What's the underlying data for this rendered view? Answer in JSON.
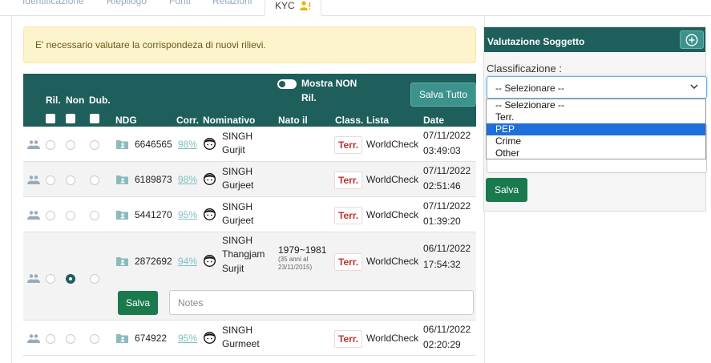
{
  "tabs": [
    {
      "label": "Identificazione"
    },
    {
      "label": "Riepilogo"
    },
    {
      "label": "Fonti"
    },
    {
      "label": "Relazioni"
    },
    {
      "label": "KYC"
    }
  ],
  "alert": "E' necessario valutare la corrispondeza di nuovi rilievi.",
  "table": {
    "headers": {
      "ril": "Ril.",
      "non": "Non",
      "dub": "Dub.",
      "ndg": "NDG",
      "corr": "Corr.",
      "nominativo": "Nominativo",
      "nato": "Nato il",
      "class": "Class.",
      "lista": "Lista",
      "date": "Date"
    },
    "toggle_label_1": "Mostra NON",
    "toggle_label_2": "Ril.",
    "save_all": "Salva Tutto",
    "rows": [
      {
        "ndg": "6646565",
        "corr": "98%",
        "name1": "SINGH",
        "name2": "Gurjit",
        "name3": "",
        "nato": "",
        "nato_note1": "",
        "nato_note2": "",
        "class": "Terr.",
        "lista": "WorldCheck",
        "date": "07/11/2022",
        "time": "03:49:03"
      },
      {
        "ndg": "6189873",
        "corr": "98%",
        "name1": "SINGH",
        "name2": "Gurjeet",
        "name3": "",
        "nato": "",
        "nato_note1": "",
        "nato_note2": "",
        "class": "Terr.",
        "lista": "WorldCheck",
        "date": "07/11/2022",
        "time": "02:51:46"
      },
      {
        "ndg": "5441270",
        "corr": "95%",
        "name1": "SINGH",
        "name2": "Gurjeet",
        "name3": "",
        "nato": "",
        "nato_note1": "",
        "nato_note2": "",
        "class": "Terr.",
        "lista": "WorldCheck",
        "date": "07/11/2022",
        "time": "01:39:20"
      },
      {
        "ndg": "2872692",
        "corr": "94%",
        "name1": "SINGH",
        "name2": "Thangjam",
        "name3": "Surjit",
        "nato": "1979~1981",
        "nato_note1": "(35 anni al",
        "nato_note2": "23/11/2015)",
        "class": "Terr.",
        "lista": "WorldCheck",
        "date": "06/11/2022",
        "time": "17:54:32"
      },
      {
        "ndg": "674922",
        "corr": "95%",
        "name1": "SINGH",
        "name2": "Gurmeet",
        "name3": "",
        "nato": "",
        "nato_note1": "",
        "nato_note2": "",
        "class": "Terr.",
        "lista": "WorldCheck",
        "date": "06/11/2022",
        "time": "02:20:29"
      }
    ],
    "expanded": {
      "save": "Salva",
      "notes_placeholder": "Notes"
    }
  },
  "side": {
    "title": "Valutazione Soggetto",
    "label": "Classificazione :",
    "selected": "-- Selezionare --",
    "options": [
      "-- Selezionare --",
      "Terr.",
      "PEP",
      "Crime",
      "Other"
    ],
    "highlighted": "PEP",
    "save": "Salva"
  },
  "colors": {
    "header": "#1e5e5b",
    "accent": "#3d938b",
    "save_green": "#1a7a4e",
    "alert_bg": "#fdf3cd",
    "badge_red": "#c0322f",
    "highlight": "#1e6fd9"
  }
}
